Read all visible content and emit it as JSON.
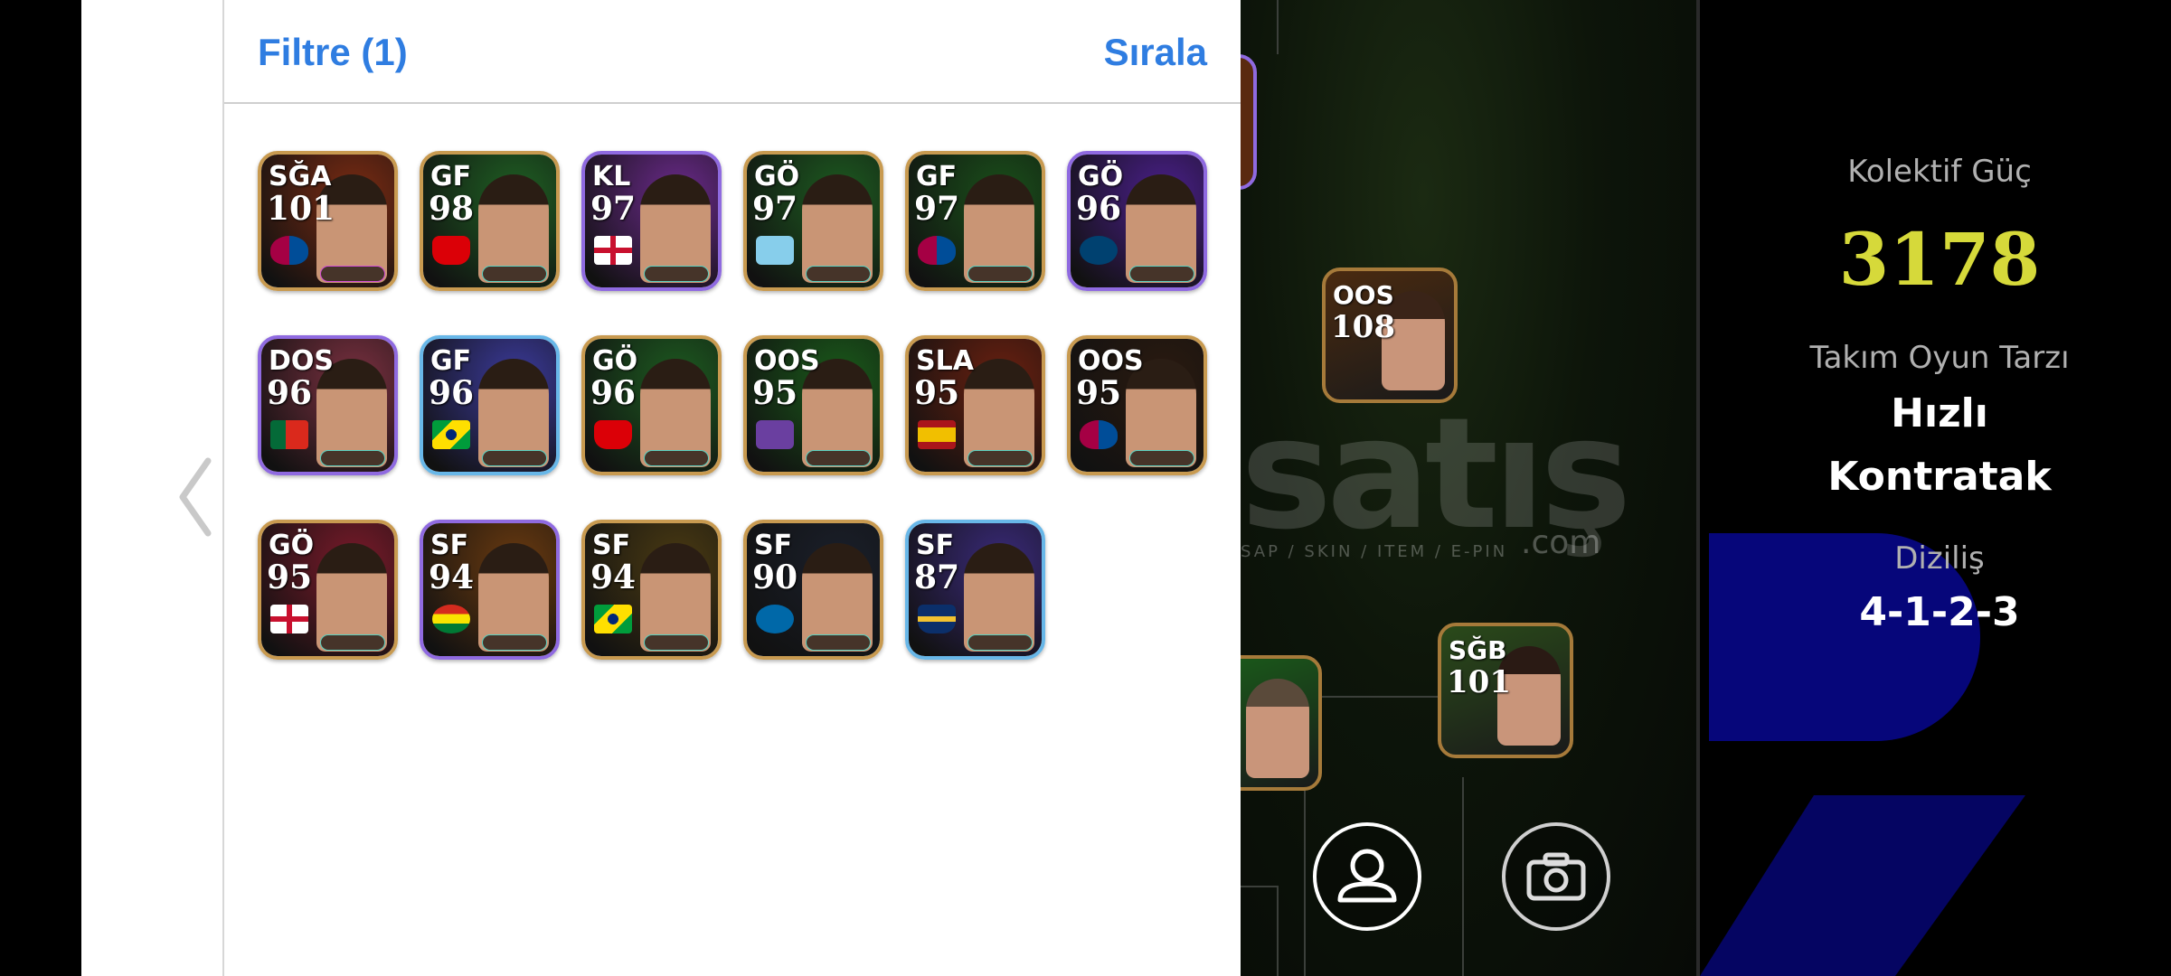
{
  "header": {
    "filter_label": "Filtre (1)",
    "sort_label": "Sırala"
  },
  "players": [
    {
      "pos": "SĞA",
      "rating": "101",
      "border": "gold",
      "bg": "#7a2b12",
      "flag": "barcelona",
      "badge": "#d24cd6"
    },
    {
      "pos": "GF",
      "rating": "98",
      "border": "gold",
      "bg": "#1f5f23",
      "flag": "arsenal",
      "badge": "#5ad0c0"
    },
    {
      "pos": "KL",
      "rating": "97",
      "border": "purple",
      "bg": "#6a2a8a",
      "flag": "england",
      "badge": "#5ad0c0"
    },
    {
      "pos": "GÖ",
      "rating": "97",
      "border": "gold",
      "bg": "#1d5a20",
      "flag": "lazio",
      "badge": "#5ad0c0"
    },
    {
      "pos": "GF",
      "rating": "97",
      "border": "gold",
      "bg": "#1a4f1a",
      "flag": "barcelona",
      "badge": "#5ad0c0"
    },
    {
      "pos": "GÖ",
      "rating": "96",
      "border": "purple",
      "bg": "#4a1f8a",
      "flag": "psg",
      "badge": "#5ad0c0"
    },
    {
      "pos": "DOS",
      "rating": "96",
      "border": "purple",
      "bg": "#7a3040",
      "flag": "portugal",
      "badge": "#5ad0c0"
    },
    {
      "pos": "GF",
      "rating": "96",
      "border": "blue",
      "bg": "#3b3a9a",
      "flag": "brazil",
      "badge": "#5ad0c0"
    },
    {
      "pos": "GÖ",
      "rating": "96",
      "border": "gold",
      "bg": "#1d5a20",
      "flag": "arsenal",
      "badge": "#5ad0c0"
    },
    {
      "pos": "OOS",
      "rating": "95",
      "border": "gold",
      "bg": "#1a5a1a",
      "flag": "fiorentina",
      "badge": "#5ad0c0"
    },
    {
      "pos": "SLA",
      "rating": "95",
      "border": "gold",
      "bg": "#6a2010",
      "flag": "spain",
      "badge": "#5ad0c0"
    },
    {
      "pos": "OOS",
      "rating": "95",
      "border": "gold",
      "bg": "#2a1a10",
      "flag": "barcelona",
      "badge": "#5ad0c0"
    },
    {
      "pos": "GÖ",
      "rating": "95",
      "border": "gold",
      "bg": "#7a1a2a",
      "flag": "england",
      "badge": "#5ad0c0"
    },
    {
      "pos": "SF",
      "rating": "94",
      "border": "purple",
      "bg": "#6a3a10",
      "flag": "bolivia",
      "badge": "#5ad0c0"
    },
    {
      "pos": "SF",
      "rating": "94",
      "border": "gold",
      "bg": "#4a3a12",
      "flag": "brazil",
      "badge": "#5ad0c0"
    },
    {
      "pos": "SF",
      "rating": "90",
      "border": "gold",
      "bg": "#1a1f2a",
      "flag": "inter",
      "badge": "#5ad0c0"
    },
    {
      "pos": "SF",
      "rating": "87",
      "border": "blue",
      "bg": "#3a2a7a",
      "flag": "boca",
      "badge": "#5ad0c0"
    }
  ],
  "pitch": {
    "cards": [
      {
        "pos": "OOS",
        "rating": "108"
      },
      {
        "pos": "SĞB",
        "rating": "101"
      },
      {
        "pos": "",
        "rating": ""
      }
    ]
  },
  "stats": {
    "power_label": "Kolektif Güç",
    "power_value": "3178",
    "style_label": "Takım Oyun Tarzı",
    "style_value_1": "Hızlı",
    "style_value_2": "Kontratak",
    "formation_label": "Diziliş",
    "formation_value": "4-1-2-3"
  },
  "watermark": {
    "main": "satış",
    "sub": "SAP / SKIN / ITEM / E-PIN",
    "domain": ".com"
  },
  "icons": [
    "chevron-left-icon",
    "user-icon",
    "camera-icon"
  ],
  "colors": {
    "accent_blue": "#2f7de1",
    "power_yellow": "#d6d93a",
    "formation_blue": "#06067a"
  }
}
